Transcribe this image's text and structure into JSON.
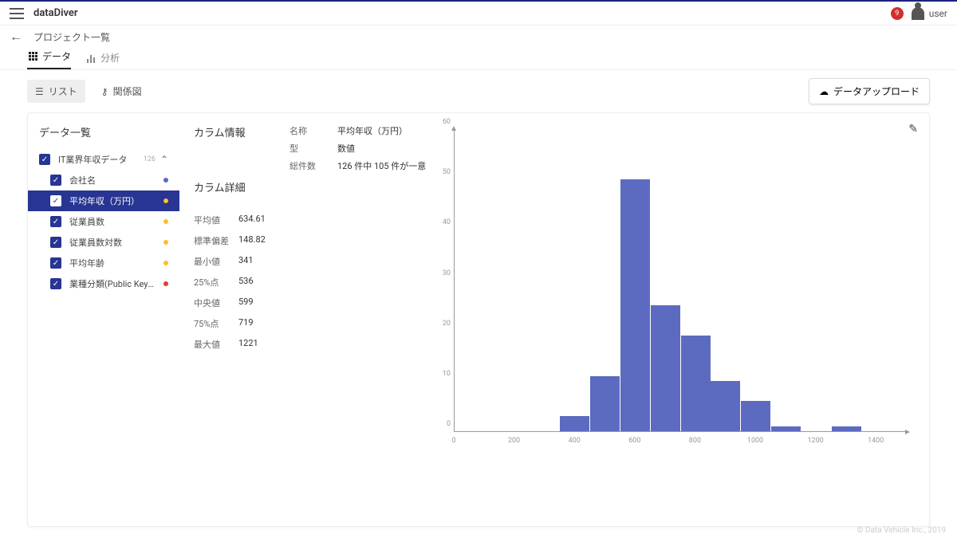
{
  "header": {
    "brand": "dataDiver",
    "badge": "9",
    "user": "user"
  },
  "subheader": {
    "breadcrumb": "プロジェクト一覧"
  },
  "tabs": [
    {
      "label": "データ",
      "active": true
    },
    {
      "label": "分析",
      "active": false
    }
  ],
  "toolbar": {
    "list": "リスト",
    "relation": "関係図",
    "upload": "データアップロード"
  },
  "sidebar": {
    "title": "データ一覧",
    "parent": {
      "label": "IT業界年収データ",
      "count": "126"
    },
    "items": [
      {
        "label": "会社名",
        "dot": "#5c6bc0"
      },
      {
        "label": "平均年収（万円）",
        "dot": "#fbc02d",
        "selected": true
      },
      {
        "label": "従業員数",
        "dot": "#fbc02d"
      },
      {
        "label": "従業員数対数",
        "dot": "#fbc02d"
      },
      {
        "label": "平均年齢",
        "dot": "#fbc02d"
      },
      {
        "label": "業種分類(Public Keyによ...",
        "dot": "#e53935"
      }
    ]
  },
  "column_info": {
    "heading": "カラム情報",
    "rows": [
      {
        "k": "名称",
        "v": "平均年収（万円）"
      },
      {
        "k": "型",
        "v": "数値"
      },
      {
        "k": "総件数",
        "v": "126 件中 105 件が一意"
      }
    ]
  },
  "column_detail": {
    "heading": "カラム詳細",
    "rows": [
      {
        "k": "平均値",
        "v": "634.61"
      },
      {
        "k": "標準偏差",
        "v": "148.82"
      },
      {
        "k": "最小値",
        "v": "341"
      },
      {
        "k": "25%点",
        "v": "536"
      },
      {
        "k": "中央値",
        "v": "599"
      },
      {
        "k": "75%点",
        "v": "719"
      },
      {
        "k": "最大値",
        "v": "1221"
      }
    ]
  },
  "chart_data": {
    "type": "bar",
    "categories": [
      400,
      500,
      600,
      700,
      800,
      900,
      1000,
      1100,
      1200,
      1300
    ],
    "values": [
      3,
      11,
      50,
      25,
      19,
      10,
      6,
      1,
      0,
      1
    ],
    "xlabel": "",
    "ylabel": "",
    "xlim": [
      0,
      1500
    ],
    "ylim": [
      0,
      60
    ],
    "xticks": [
      0,
      200,
      400,
      600,
      800,
      1000,
      1200,
      1400
    ],
    "yticks": [
      0,
      10,
      20,
      30,
      40,
      50,
      60
    ]
  },
  "footer": "© Data Vehicle Inc., 2019"
}
